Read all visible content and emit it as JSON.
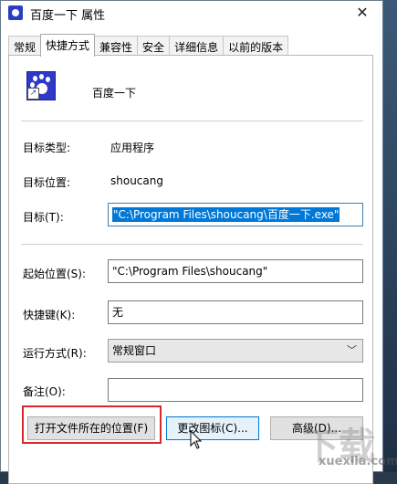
{
  "window": {
    "title": "百度一下 属性",
    "close_glyph": "✕"
  },
  "tabs": [
    {
      "label": "常规"
    },
    {
      "label": "快捷方式",
      "active": true
    },
    {
      "label": "兼容性"
    },
    {
      "label": "安全"
    },
    {
      "label": "详细信息"
    },
    {
      "label": "以前的版本"
    }
  ],
  "shortcut": {
    "name": "百度一下",
    "icon": "baidu-paw-shortcut-icon",
    "target_type_label": "目标类型:",
    "target_type_value": "应用程序",
    "target_location_label": "目标位置:",
    "target_location_value": "shoucang",
    "target_label": "目标(T):",
    "target_value": "\"C:\\Program Files\\shoucang\\百度一下.exe\"",
    "start_in_label": "起始位置(S):",
    "start_in_value": "\"C:\\Program Files\\shoucang\"",
    "hotkey_label": "快捷键(K):",
    "hotkey_value": "无",
    "run_label": "运行方式(R):",
    "run_value": "常规窗口",
    "comment_label": "备注(O):",
    "comment_value": ""
  },
  "buttons": {
    "open_location": "打开文件所在的位置(F)",
    "change_icon": "更改图标(C)...",
    "advanced": "高级(D)..."
  },
  "watermark": {
    "text": "下载",
    "url": "xuexila.com"
  },
  "colors": {
    "highlight": "#0078d7",
    "annotation": "#d62a2a",
    "icon_blue": "#2e39c9"
  }
}
